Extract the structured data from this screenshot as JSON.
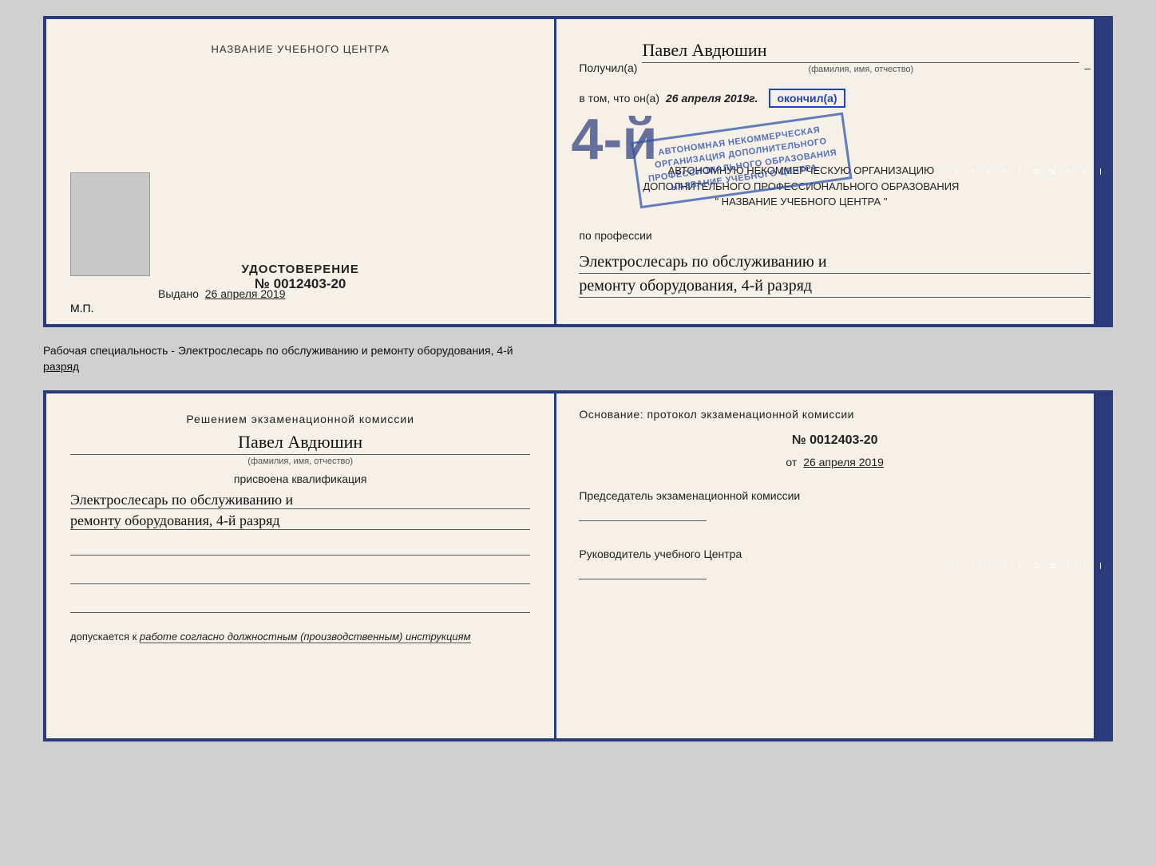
{
  "top_doc": {
    "left": {
      "title": "НАЗВАНИЕ УЧЕБНОГО ЦЕНТРА",
      "udostoverenie_label": "УДОСТОВЕРЕНИЕ",
      "number": "№ 0012403-20",
      "vydano_label": "Выдано",
      "vydano_date": "26 апреля 2019",
      "mp_label": "М.П."
    },
    "right": {
      "poluchil_label": "Получил(а)",
      "person_name": "Павел Авдюшин",
      "fio_caption": "(фамилия, имя, отчество)",
      "vtom_label": "в том, что он(а)",
      "vtom_date": "26 апреля 2019г.",
      "okonchil_label": "окончил(а)",
      "big_number": "4-й",
      "org_line1": "АВТОНОМНУЮ НЕКОММЕРЧЕСКУЮ ОРГАНИЗАЦИЮ",
      "org_line2": "ДОПОЛНИТЕЛЬНОГО ПРОФЕССИОНАЛЬНОГО ОБРАЗОВАНИЯ",
      "org_line3": "\" НАЗВАНИЕ УЧЕБНОГО ЦЕНТРА \"",
      "po_professii_label": "по профессии",
      "profession_line1": "Электрослесарь по обслуживанию и",
      "profession_line2": "ремонту оборудования, 4-й разряд",
      "stamp_line1": "АВТОНОМНАЯ НЕКОММЕРЧЕСКАЯ",
      "stamp_line2": "ОРГАНИЗАЦИЯ ДОПОЛНИТЕЛЬНОГО",
      "stamp_line3": "ПРОФЕССИОНАЛЬНОГО ОБРАЗОВАНИЯ",
      "stamp_line4": "НАЗВАНИЕ УЧЕБНОГО ЦЕНТРА"
    },
    "deco": [
      "–",
      "–",
      "–",
      "и",
      "а",
      "←",
      "–",
      "–",
      "–",
      "–"
    ]
  },
  "middle_text": {
    "line1": "Рабочая специальность - Электрослесарь по обслуживанию и ремонту оборудования, 4-й",
    "line2": "разряд"
  },
  "bottom_doc": {
    "left": {
      "resheniem_label": "Решением экзаменационной комиссии",
      "person_name": "Павел Авдюшин",
      "fio_caption": "(фамилия, имя, отчество)",
      "prisvoena_label": "присвоена квалификация",
      "kvalif_line1": "Электрослесарь по обслуживанию и",
      "kvalif_line2": "ремонту оборудования, 4-й разряд",
      "dopuskaetsya_label": "допускается к",
      "dopuskaetsya_value": "работе согласно должностным (производственным) инструкциям"
    },
    "right": {
      "osnovanie_label": "Основание: протокол экзаменационной комиссии",
      "number": "№ 0012403-20",
      "ot_label": "от",
      "ot_date": "26 апреля 2019",
      "predsedatel_label": "Председатель экзаменационной комиссии",
      "rukovoditel_label": "Руководитель учебного Центра"
    },
    "deco": [
      "–",
      "–",
      "–",
      "и",
      "а",
      "←",
      "–",
      "–",
      "–",
      "–"
    ]
  }
}
